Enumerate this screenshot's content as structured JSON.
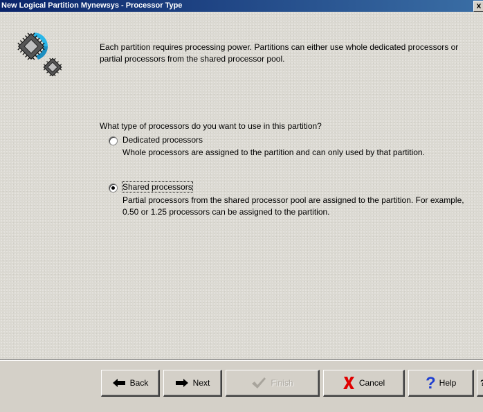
{
  "window": {
    "title": "New Logical Partition Mynewsys - Processor Type",
    "close_glyph": "x"
  },
  "icons": {
    "large_chip": "processor-chip-icon",
    "small_chip": "processor-chip-icon",
    "accent_color": "#29b6e8"
  },
  "intro_text": "Each partition requires processing power.  Partitions can either use whole dedicated processors or partial processors from the shared processor pool.",
  "question": "What type of processors do you want to use in this partition?",
  "options": [
    {
      "label": "Dedicated processors",
      "description": "Whole processors are assigned to the partition and can only used by that partition.",
      "selected": false
    },
    {
      "label": "Shared processors",
      "description": "Partial processors from the shared processor pool are assigned to the partition. For example, 0.50 or 1.25 processors can be assigned to the partition.",
      "selected": true
    }
  ],
  "buttons": {
    "back": "Back",
    "next": "Next",
    "finish": "Finish",
    "cancel": "Cancel",
    "help": "Help",
    "whats_this": "?"
  }
}
